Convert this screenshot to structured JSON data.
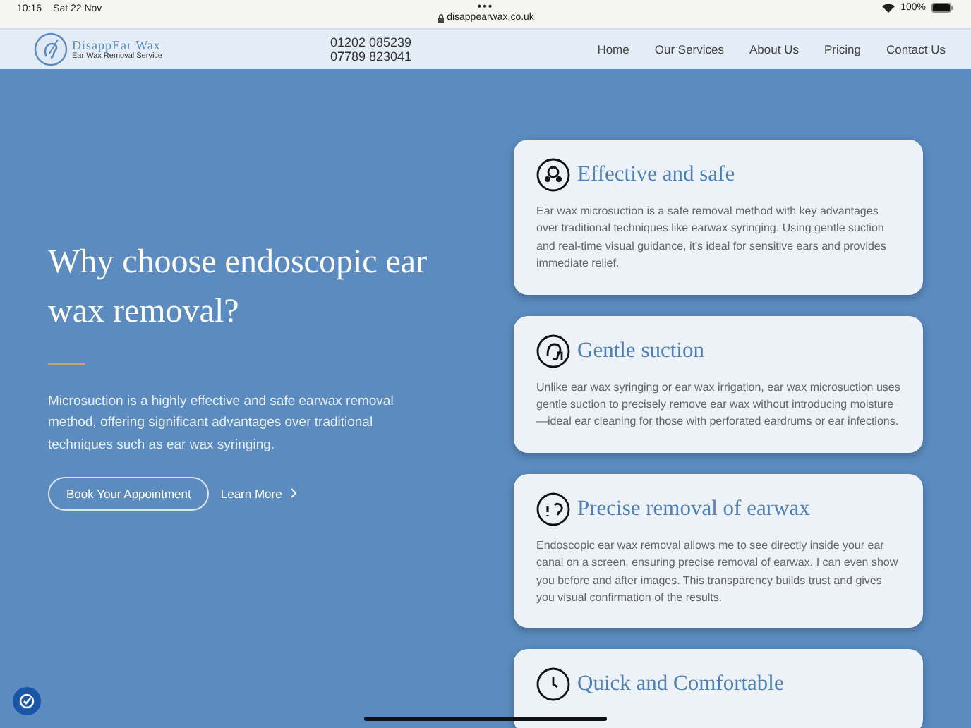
{
  "status_bar": {
    "time": "10:16",
    "date": "Sat 22 Nov",
    "dots": "•••",
    "url": "disappearwax.co.uk",
    "battery": "100%"
  },
  "header": {
    "logo_title": "DisappEar Wax",
    "logo_subtitle": "Ear Wax Removal Service",
    "phones": [
      "01202 085239",
      "07789 823041"
    ],
    "nav": [
      {
        "label": "Home"
      },
      {
        "label": "Our Services"
      },
      {
        "label": "About Us"
      },
      {
        "label": "Pricing"
      },
      {
        "label": "Contact Us"
      }
    ]
  },
  "hero": {
    "heading": "Why choose endoscopic ear wax removal?",
    "text": "Microsuction is a highly effective and safe earwax removal method, offering significant advantages over traditional techniques such as ear wax syringing.",
    "primary_button": "Book Your Appointment",
    "link": "Learn More"
  },
  "cards": [
    {
      "title": "Effective and safe",
      "text": "Ear wax microsuction is a safe removal method with key advantages over traditional techniques like earwax syringing. Using gentle suction and real-time visual guidance, it's ideal for sensitive ears and provides immediate relief."
    },
    {
      "title": "Gentle suction",
      "text": "Unlike ear wax syringing or ear wax irrigation, ear wax microsuction uses gentle suction to precisely remove ear wax without introducing moisture—ideal ear cleaning for those with perforated eardrums or ear infections."
    },
    {
      "title": "Precise removal of earwax",
      "text": "Endoscopic ear wax removal allows me to see directly inside your ear canal on a screen, ensuring precise removal of earwax. I can even show you before and after images. This transparency builds trust and gives you visual confirmation of the results."
    },
    {
      "title": "Quick and Comfortable"
    }
  ]
}
